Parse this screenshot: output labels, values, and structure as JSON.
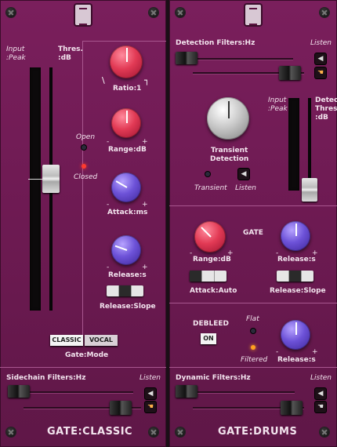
{
  "left": {
    "input_label": "Input\n:Peak",
    "thres_label": "Thres.\n:dB",
    "ratio_label": "Ratio:1",
    "open_label": "Open",
    "closed_label": "Closed",
    "range_label": "Range:dB",
    "attack_label": "Attack:ms",
    "release_label": "Release:s",
    "release_slope_label": "Release:Slope",
    "mode_classic": "CLASSIC",
    "mode_vocal": "VOCAL",
    "gate_mode_label": "Gate:Mode",
    "sidechain_label": "Sidechain Filters:Hz",
    "listen_label": "Listen",
    "footer_title": "GATE:CLASSIC",
    "knob_minus": "-",
    "knob_plus": "+"
  },
  "right": {
    "detection_label": "Detection Filters:Hz",
    "listen_label": "Listen",
    "transient_detection_label": "Transient\nDetection",
    "transient_label": "Transient",
    "listen2_label": "Listen",
    "input_label": "Input\n:Peak",
    "detect_thres_label": "Detect\nThres.\n:dB",
    "gate_label": "GATE",
    "range_label": "Range:dB",
    "release_label": "Release:s",
    "attack_label": "Attack:Auto",
    "release_slope_label": "Release:Slope",
    "debleed_label": "DEBLEED",
    "on_label": "ON",
    "flat_label": "Flat",
    "filtered_label": "Filtered",
    "release2_label": "Release:s",
    "dynamic_label": "Dynamic Filters:Hz",
    "listen3_label": "Listen",
    "footer_title": "GATE:DRUMS",
    "knob_minus": "-",
    "knob_plus": "+"
  },
  "colors": {
    "panel": "#6d1a52",
    "red_knob": "#e23a55",
    "purple_knob": "#6d52d8",
    "led_red": "#ff3b2f",
    "led_orange": "#ffa020"
  }
}
